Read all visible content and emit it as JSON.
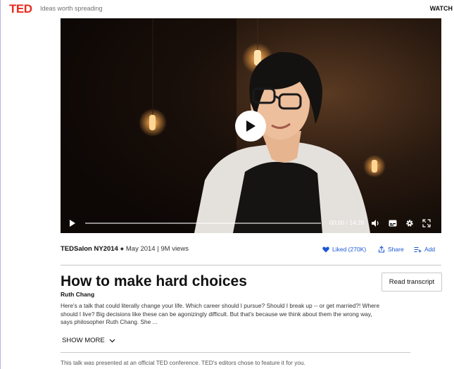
{
  "header": {
    "logo": "TED",
    "tagline": "Ideas worth spreading",
    "watch_label": "WATCH"
  },
  "video": {
    "time_display": "00:00 / 14:28",
    "progress": 0
  },
  "meta": {
    "event": "TEDSalon NY2014",
    "date": "May 2014",
    "views": "9M views"
  },
  "actions": {
    "liked_label": "Liked (270K)",
    "share_label": "Share",
    "add_label": "Add"
  },
  "talk": {
    "title": "How to make hard choices",
    "speaker": "Ruth Chang",
    "transcript_button": "Read transcript",
    "description": "Here's a talk that could literally change your life. Which career should I pursue? Should I break up -- or get married?! Where should I live? Big decisions like these can be agonizingly difficult. But that's because we think about them the wrong way, says philosopher Ruth Chang. She ...",
    "show_more": "SHOW MORE",
    "footnote": "This talk was presented at an official TED conference. TED's editors chose to feature it for you."
  },
  "colors": {
    "brand": "#e62b1e",
    "link": "#1a56d6"
  }
}
